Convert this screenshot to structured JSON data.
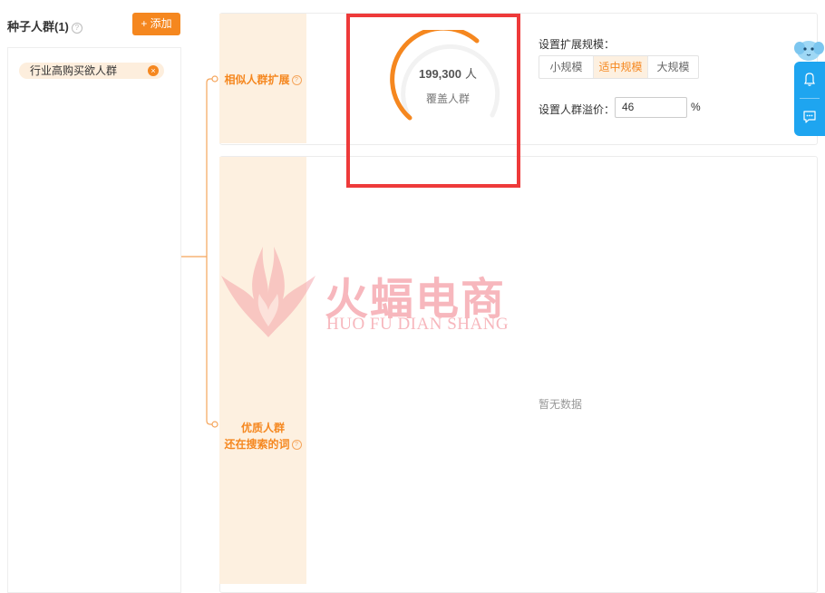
{
  "seed": {
    "title": "种子人群(1)",
    "help_icon": "?",
    "add_label": "+ 添加",
    "tags": [
      {
        "label": "行业高购买欲人群",
        "remove_icon": "×"
      }
    ]
  },
  "similar": {
    "label": "相似人群扩展",
    "help_icon": "?",
    "gauge_value": "199,300",
    "gauge_unit": "人",
    "gauge_caption": "覆盖人群",
    "scale_label": "设置扩展规模：",
    "scale_options": [
      "小规模",
      "适中规模",
      "大规模"
    ],
    "scale_selected": "适中规模",
    "premium_label": "设置人群溢价：",
    "premium_value": "46",
    "premium_unit": "%"
  },
  "quality": {
    "label_line1": "优质人群",
    "label_line2": "还在搜索的词",
    "help_icon": "?",
    "empty_text": "暂无数据"
  },
  "watermark": {
    "text_cn": "火蝠电商",
    "text_en": "HUO FU DIAN SHANG"
  },
  "colors": {
    "accent": "#f5871f",
    "accent_light": "#fdf0e0",
    "highlight": "#ee3a3a",
    "float_blue": "#1ea5f0"
  },
  "icons": {
    "bell": "bell-icon",
    "chat": "chat-icon",
    "mascot": "mascot-icon"
  }
}
